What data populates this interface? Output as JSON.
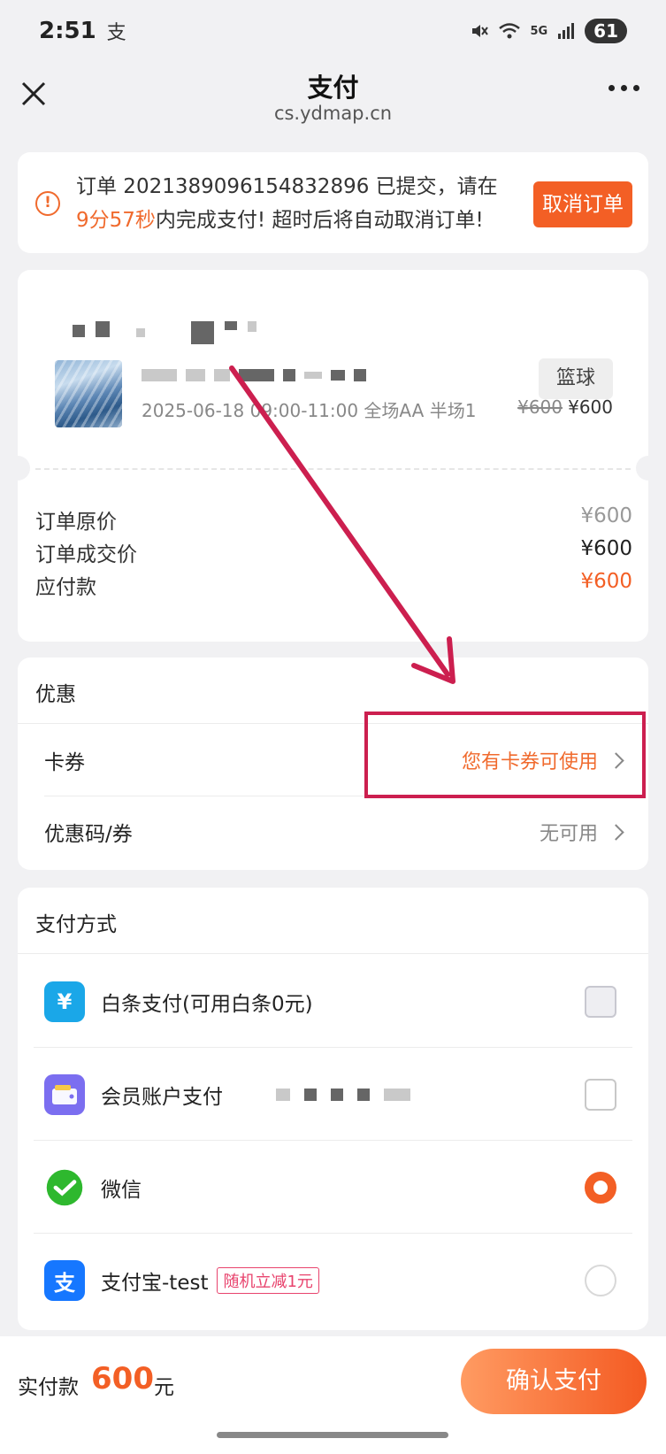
{
  "status_bar": {
    "time": "2:51",
    "app_glyph": "支",
    "network": "5G",
    "battery": "61"
  },
  "nav": {
    "title": "支付",
    "url": "cs.ydmap.cn"
  },
  "notice": {
    "line1": "订单 2021389096154832896 已提交，请在",
    "countdown": "9分57秒",
    "line2_rest": "内完成支付! 超时后将自动取消订单!",
    "cancel_label": "取消订单"
  },
  "order": {
    "tag": "篮球",
    "detail": "2025-06-18 09:00-11:00 全场AA 半场1",
    "price_original": "¥600",
    "price_now": "¥600",
    "rows": [
      {
        "label": "订单原价",
        "value": "¥600",
        "color": "#999999"
      },
      {
        "label": "订单成交价",
        "value": "¥600",
        "color": "#222222"
      },
      {
        "label": "应付款",
        "value": "¥600",
        "color": "#f35f25"
      }
    ]
  },
  "promo": {
    "title": "优惠",
    "card_label": "卡券",
    "card_value": "您有卡券可使用",
    "code_label": "优惠码/券",
    "code_value": "无可用"
  },
  "payments": {
    "title": "支付方式",
    "methods": [
      {
        "label": "白条支付(可用白条0元)",
        "icon": "baitiao-icon",
        "state": "disabled"
      },
      {
        "label": "会员账户支付",
        "icon": "wallet-icon",
        "state": "unchecked"
      },
      {
        "label": "微信",
        "icon": "wechat-icon",
        "state": "selected"
      },
      {
        "label": "支付宝-test",
        "icon": "alipay-icon",
        "state": "unselected",
        "badge": "随机立减1元"
      }
    ]
  },
  "bottom": {
    "total_label": "实付款",
    "total_amount": "600",
    "total_unit": "元",
    "confirm_label": "确认支付"
  },
  "colors": {
    "accent": "#f35f25",
    "annotation": "#cc1f4f"
  }
}
